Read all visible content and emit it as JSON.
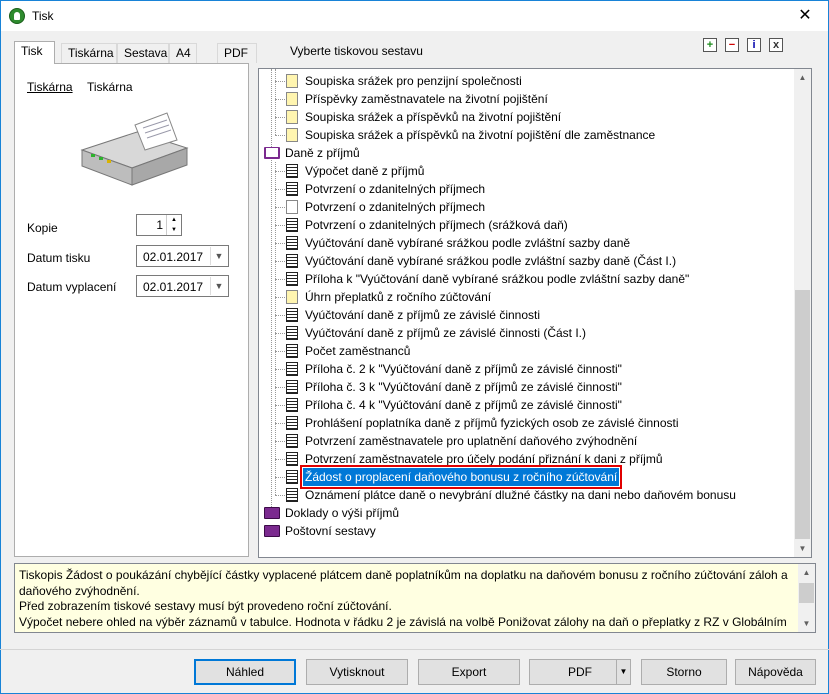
{
  "window": {
    "title": "Tisk",
    "close_glyph": "✕"
  },
  "tabs": [
    {
      "label": "Tisk",
      "active": true
    },
    {
      "label": "Tiskárna"
    },
    {
      "label": "Sestava"
    },
    {
      "label": "A4"
    },
    {
      "label": "PDF"
    }
  ],
  "report_prompt": "Vyberte tiskovou sestavu",
  "toolbar": {
    "add": "+",
    "remove": "−",
    "info": "i",
    "export": "x"
  },
  "printer": {
    "label": "Tiskárna",
    "value": "Tiskárna"
  },
  "fields": {
    "kopie_label": "Kopie",
    "kopie_value": "1",
    "datum_tisku_label": "Datum tisku",
    "datum_tisku_value": "02.01.2017",
    "datum_vyplaceni_label": "Datum vyplacení",
    "datum_vyplaceni_value": "02.01.2017"
  },
  "tree": [
    {
      "level": 2,
      "icon": "yellow",
      "text": "Soupiska srážek pro penzijní společnosti"
    },
    {
      "level": 2,
      "icon": "yellow",
      "text": "Příspěvky zaměstnavatele na životní pojištění"
    },
    {
      "level": 2,
      "icon": "yellow",
      "text": "Soupiska srážek a příspěvků na životní pojištění"
    },
    {
      "level": 2,
      "icon": "yellow",
      "text": "Soupiska srážek a příspěvků na životní pojištění dle zaměstnance"
    },
    {
      "level": 1,
      "icon": "book-open",
      "text": "Daně z příjmů"
    },
    {
      "level": 2,
      "icon": "lines",
      "text": "Výpočet daně z příjmů"
    },
    {
      "level": 2,
      "icon": "lines",
      "text": "Potvrzení o zdanitelných příjmech"
    },
    {
      "level": 2,
      "icon": "white",
      "text": "Potvrzení o zdanitelných příjmech"
    },
    {
      "level": 2,
      "icon": "lines",
      "text": "Potvrzení o zdanitelných příjmech (srážková daň)"
    },
    {
      "level": 2,
      "icon": "lines",
      "text": "Vyúčtování daně vybírané srážkou podle zvláštní sazby daně"
    },
    {
      "level": 2,
      "icon": "lines",
      "text": "Vyúčtování daně vybírané srážkou podle zvláštní sazby daně (Část I.)"
    },
    {
      "level": 2,
      "icon": "lines",
      "text": "Příloha k \"Vyúčtování daně vybírané srážkou podle zvláštní sazby daně\""
    },
    {
      "level": 2,
      "icon": "yellow",
      "text": "Úhrn přeplatků z ročního zúčtování"
    },
    {
      "level": 2,
      "icon": "lines",
      "text": "Vyúčtování daně z příjmů ze závislé činnosti"
    },
    {
      "level": 2,
      "icon": "lines",
      "text": "Vyúčtování daně z příjmů ze závislé činnosti (Část I.)"
    },
    {
      "level": 2,
      "icon": "lines",
      "text": "Počet zaměstnanců"
    },
    {
      "level": 2,
      "icon": "lines",
      "text": "Příloha č. 2 k \"Vyúčtování daně z příjmů ze závislé činnosti\""
    },
    {
      "level": 2,
      "icon": "lines",
      "text": "Příloha č. 3 k \"Vyúčtování daně z příjmů ze závislé činnosti\""
    },
    {
      "level": 2,
      "icon": "lines",
      "text": "Příloha č. 4 k \"Vyúčtování daně z příjmů ze závislé činnosti\""
    },
    {
      "level": 2,
      "icon": "lines",
      "text": "Prohlášení poplatníka daně z příjmů fyzických osob ze závislé činnosti"
    },
    {
      "level": 2,
      "icon": "lines",
      "text": "Potvrzení zaměstnavatele pro uplatnění daňového zvýhodnění"
    },
    {
      "level": 2,
      "icon": "lines",
      "text": "Potvrzení zaměstnavatele pro účely podání přiznání k dani z příjmů"
    },
    {
      "level": 2,
      "icon": "lines",
      "text": "Žádost o proplacení daňového bonusu z ročního zúčtování",
      "selected": true
    },
    {
      "level": 2,
      "icon": "lines",
      "text": "Oznámení plátce daně o nevybrání dlužné částky na dani nebo daňovém bonusu"
    },
    {
      "level": 1,
      "icon": "book",
      "text": "Doklady o výši příjmů"
    },
    {
      "level": 1,
      "icon": "book",
      "text": "Poštovní sestavy"
    }
  ],
  "description": [
    "Tiskopis Žádost o poukázání chybějící částky vyplacené plátcem daně poplatníkům na doplatku na daňovém bonusu z ročního zúčtování záloh a",
    "daňového zvýhodnění.",
    "Před zobrazením tiskové sestavy musí být provedeno roční zúčtování.",
    "Výpočet nebere ohled na výběr záznamů v tabulce. Hodnota v řádku 2 je závislá na volbě Ponižovat zálohy na daň o přeplatky z RZ v Globálním"
  ],
  "buttons": {
    "nahled": "Náhled",
    "vytisknout": "Vytisknout",
    "export": "Export",
    "pdf": "PDF",
    "storno": "Storno",
    "napoveda": "Nápověda"
  },
  "colors": {
    "selection": "#0078d7",
    "highlight_border": "#e00000",
    "desc_bg": "#ffffe1"
  }
}
